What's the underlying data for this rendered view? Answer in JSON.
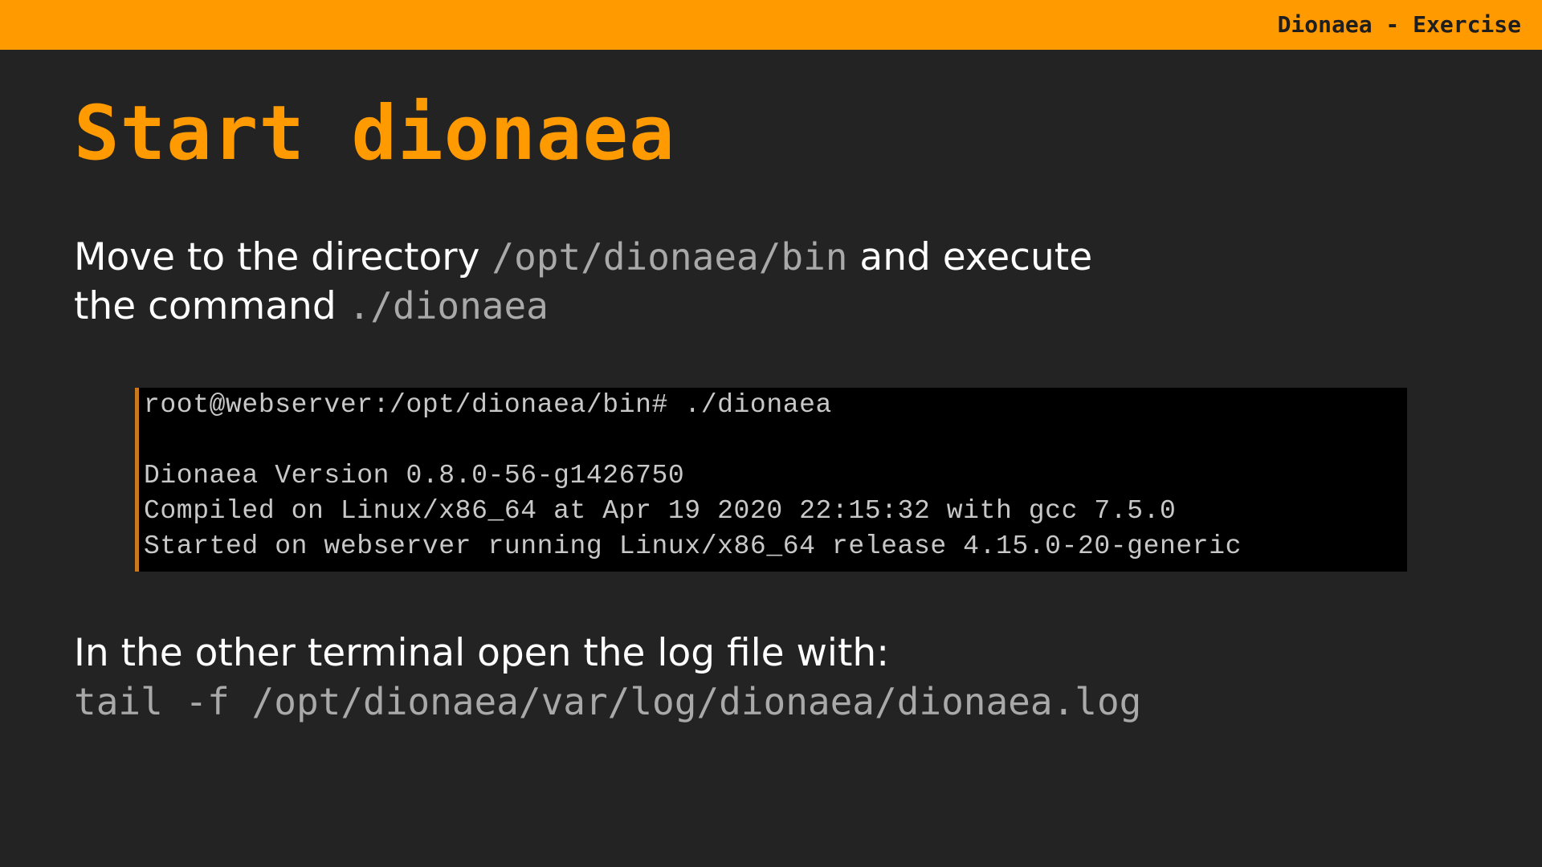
{
  "header": {
    "title": "Dionaea - Exercise"
  },
  "slide": {
    "title": "Start dionaea",
    "para1": {
      "text_a": "Move to the directory ",
      "code_a": "/opt/dionaea/bin",
      "text_b": " and execute",
      "text_c": "the command ",
      "code_b": "./dionaea"
    },
    "terminal": {
      "lines": [
        "root@webserver:/opt/dionaea/bin# ./dionaea",
        "",
        "Dionaea Version 0.8.0-56-g1426750",
        "Compiled on Linux/x86_64 at Apr 19 2020 22:15:32 with gcc 7.5.0",
        "Started on webserver running Linux/x86_64 release 4.15.0-20-generic"
      ]
    },
    "para2": {
      "text": "In the other terminal open the log file with:",
      "code": "tail -f /opt/dionaea/var/log/dionaea/dionaea.log"
    }
  },
  "colors": {
    "accent": "#ff9a00",
    "background": "#232323",
    "text": "#ffffff",
    "code_text": "#a9a9a9",
    "terminal_bg": "#000000"
  }
}
